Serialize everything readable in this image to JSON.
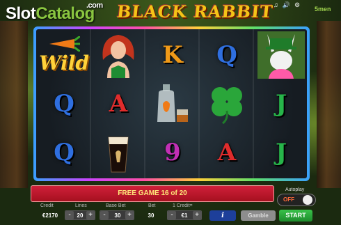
{
  "watermark": {
    "part1": "Slot",
    "part2": "Catalog",
    "com": ".com"
  },
  "game_title": "BLACK RABBIT",
  "top_icons": [
    "music-note-icon",
    "sound-icon",
    "settings-icon"
  ],
  "brand": "5men",
  "reels": [
    [
      {
        "type": "icon",
        "name": "wild-carrot-icon",
        "label": "Wild"
      },
      {
        "type": "letter",
        "value": "Q"
      },
      {
        "type": "letter",
        "value": "Q"
      }
    ],
    [
      {
        "type": "icon",
        "name": "redhead-woman-icon"
      },
      {
        "type": "letter",
        "value": "A"
      },
      {
        "type": "icon",
        "name": "stout-beer-icon"
      }
    ],
    [
      {
        "type": "letter",
        "value": "K"
      },
      {
        "type": "icon",
        "name": "bottle-and-glass-icon"
      },
      {
        "type": "letter",
        "value": "9"
      }
    ],
    [
      {
        "type": "letter",
        "value": "Q"
      },
      {
        "type": "icon",
        "name": "four-leaf-clover-icon"
      },
      {
        "type": "letter",
        "value": "A"
      }
    ],
    [
      {
        "type": "icon",
        "name": "leprechaun-rabbit-icon"
      },
      {
        "type": "letter",
        "value": "J"
      },
      {
        "type": "letter",
        "value": "J"
      }
    ]
  ],
  "free_game_text": "FREE GAME 16 of 20",
  "autoplay": {
    "label": "Autoplay",
    "state": "OFF"
  },
  "controls": {
    "credit": {
      "label": "Credit",
      "value": "€2170"
    },
    "lines": {
      "label": "Lines",
      "value": "20"
    },
    "base_bet": {
      "label": "Base Bet",
      "value": "30"
    },
    "bet": {
      "label": "Bet",
      "value": "30"
    },
    "one_credit": {
      "label": "1 Credit=",
      "value": "€1"
    },
    "info_label": "i",
    "gamble_label": "Gamble",
    "start_label": "START"
  }
}
